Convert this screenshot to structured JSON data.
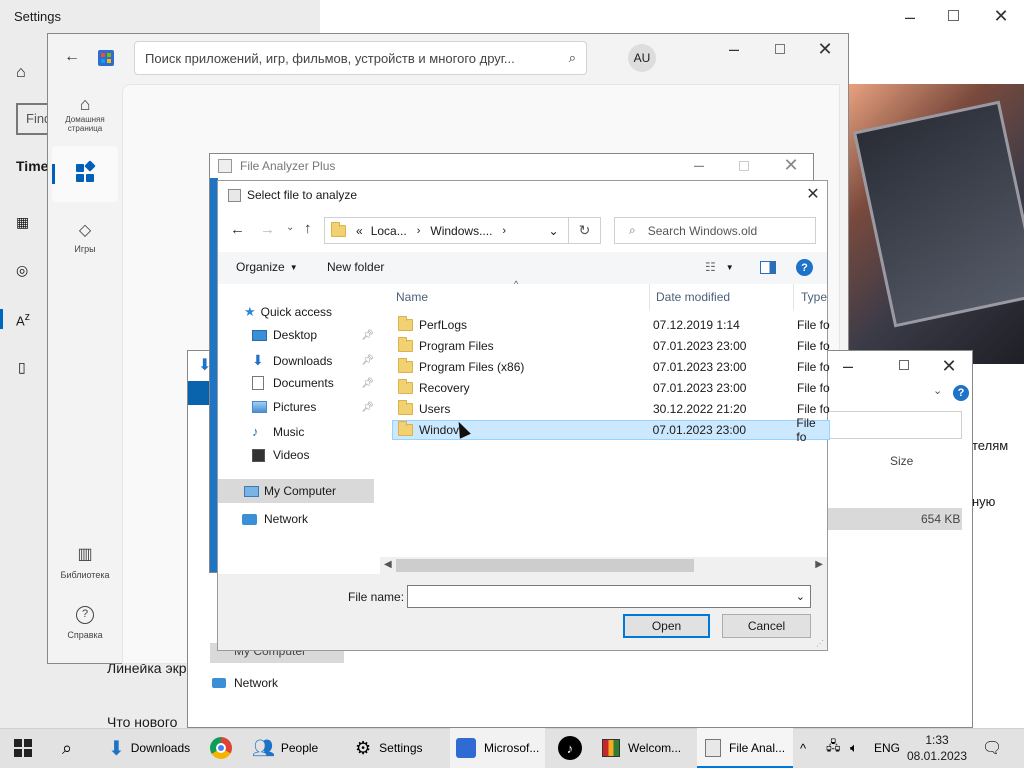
{
  "settings": {
    "title": "Settings",
    "search_placeholder": "Find",
    "section": "Time",
    "side_items": [
      "Линейка экр",
      "Что нового"
    ],
    "side_right": [
      "телям",
      "ную"
    ]
  },
  "store": {
    "search_placeholder": "Поиск приложений, игр, фильмов, устройств и многого друг...",
    "avatar": "AU",
    "nav": [
      {
        "label": "Домашняя страница"
      },
      {
        "label": ""
      },
      {
        "label": "Игры"
      },
      {
        "label": "Библиотека"
      },
      {
        "label": "Справка"
      }
    ]
  },
  "fap": {
    "title": "File Analyzer Plus"
  },
  "back_dialog": {
    "size_header": "Size",
    "size_value": "654 KB",
    "my_computer": "My Computer",
    "network": "Network"
  },
  "dialog": {
    "title": "Select file to analyze",
    "breadcrumb": [
      "Loca...",
      "Windows...."
    ],
    "breadcrumb_prefix": "«",
    "search_placeholder": "Search Windows.old",
    "organize": "Organize",
    "new_folder": "New folder",
    "columns": {
      "name": "Name",
      "date": "Date modified",
      "type": "Type"
    },
    "nav": {
      "quick_access": "Quick access",
      "items": [
        "Desktop",
        "Downloads",
        "Documents",
        "Pictures",
        "Music",
        "Videos"
      ],
      "my_computer": "My Computer",
      "network": "Network"
    },
    "files": [
      {
        "name": "PerfLogs",
        "date": "07.12.2019 1:14",
        "type": "File fo"
      },
      {
        "name": "Program Files",
        "date": "07.01.2023 23:00",
        "type": "File fo"
      },
      {
        "name": "Program Files (x86)",
        "date": "07.01.2023 23:00",
        "type": "File fo"
      },
      {
        "name": "Recovery",
        "date": "07.01.2023 23:00",
        "type": "File fo"
      },
      {
        "name": "Users",
        "date": "30.12.2022 21:20",
        "type": "File fo"
      },
      {
        "name": "Windov",
        "date": "07.01.2023 23:00",
        "type": "File fo"
      }
    ],
    "filename_label": "File name:",
    "filename_value": "",
    "open": "Open",
    "cancel": "Cancel"
  },
  "taskbar": {
    "items": [
      "Downloads",
      "People",
      "Settings",
      "Microsof...",
      "Welcom...",
      "File Anal..."
    ],
    "lang": "ENG",
    "time": "1:33",
    "date": "08.01.2023"
  }
}
